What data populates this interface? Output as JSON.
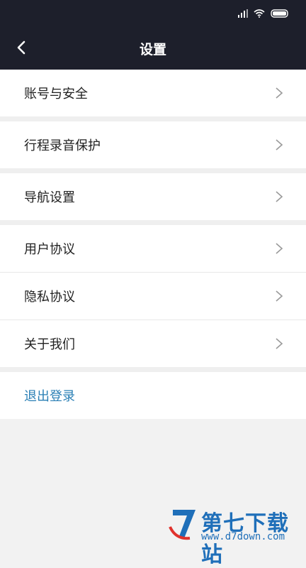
{
  "header": {
    "title": "设置"
  },
  "menu": [
    {
      "label": "账号与安全"
    },
    {
      "label": "行程录音保护"
    },
    {
      "label": "导航设置"
    },
    {
      "label": "用户协议"
    },
    {
      "label": "隐私协议"
    },
    {
      "label": "关于我们"
    }
  ],
  "logout": {
    "label": "退出登录"
  },
  "watermark": {
    "brand": "第七下载站",
    "url": "www.d7down.com"
  },
  "colors": {
    "header_bg": "#1d1f2b",
    "logout_text": "#2a7fb5",
    "page_bg": "#f2f2f2"
  }
}
